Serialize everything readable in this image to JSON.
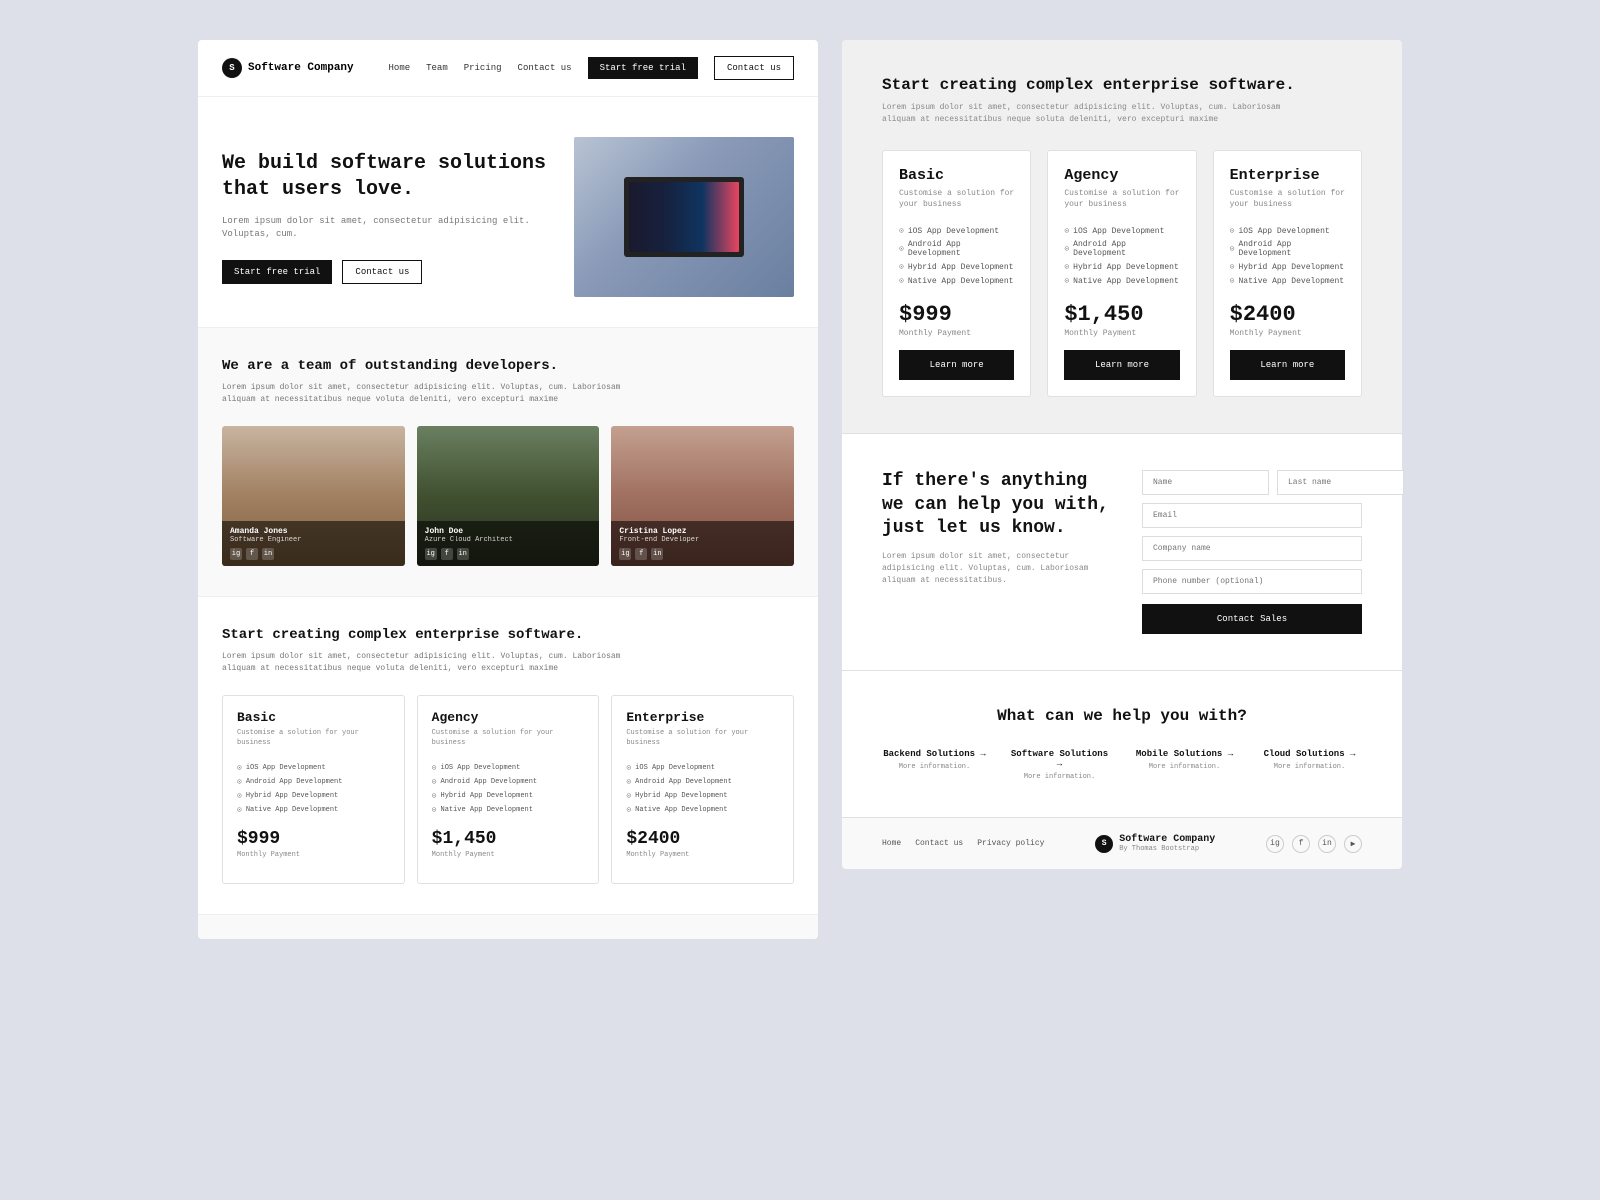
{
  "nav": {
    "logo_initial": "S",
    "logo_text": "Software Company",
    "links": [
      "Home",
      "Team",
      "Pricing",
      "Contact us"
    ],
    "cta_primary": "Start free trial",
    "cta_secondary": "Contact us"
  },
  "hero": {
    "title": "We build software solutions that users love.",
    "subtitle": "Lorem ipsum dolor sit amet, consectetur adipisicing elit. Voluptas, cum.",
    "btn_primary": "Start free trial",
    "btn_secondary": "Contact us"
  },
  "team": {
    "title": "We are a team of outstanding developers.",
    "subtitle": "Lorem ipsum dolor sit amet, consectetur adipisicing elit. Voluptas, cum. Laboriosam aliquam at necessitatibus neque voluta deleniti, vero excepturi maxime",
    "members": [
      {
        "name": "Amanda Jones",
        "role": "Software Engineer"
      },
      {
        "name": "John Doe",
        "role": "Azure Cloud Architect"
      },
      {
        "name": "Cristina Lopez",
        "role": "Front-end Developer"
      }
    ]
  },
  "left_pricing": {
    "title": "Start creating complex enterprise software.",
    "subtitle": "Lorem ipsum dolor sit amet, consectetur adipisicing elit. Voluptas, cum. Laboriosam aliquam at necessitatibus neque voluta deleniti, vero excepturi maxime",
    "plans": [
      {
        "name": "Basic",
        "desc": "Customise a solution for your business",
        "features": [
          "iOS App Development",
          "Android App Development",
          "Hybrid App Development",
          "Native App Development"
        ],
        "price": "$999",
        "period": "Monthly Payment"
      },
      {
        "name": "Agency",
        "desc": "Customise a solution for your business",
        "features": [
          "iOS App Development",
          "Android App Development",
          "Hybrid App Development",
          "Native App Development"
        ],
        "price": "$1,450",
        "period": "Monthly Payment"
      },
      {
        "name": "Enterprise",
        "desc": "Customise a solution for your business",
        "features": [
          "iOS App Development",
          "Android App Development",
          "Hybrid App Development",
          "Native App Development"
        ],
        "price": "$2400",
        "period": "Monthly Payment"
      }
    ]
  },
  "right_pricing": {
    "title": "Start creating complex enterprise software.",
    "subtitle": "Lorem ipsum dolor sit amet, consectetur adipisicing elit. Voluptas, cum. Laboriosam aliquam at necessitatibus neque soluta deleniti, vero excepturi maxime",
    "plans": [
      {
        "name": "Basic",
        "desc": "Customise a solution for your business",
        "features": [
          "iOS App Development",
          "Android App Development",
          "Hybrid App Development",
          "Native App Development"
        ],
        "price": "$999",
        "period": "Monthly Payment",
        "btn": "Learn more"
      },
      {
        "name": "Agency",
        "desc": "Customise a solution for your business",
        "features": [
          "iOS App Development",
          "Android App Development",
          "Hybrid App Development",
          "Native App Development"
        ],
        "price": "$1,450",
        "period": "Monthly Payment",
        "btn": "Learn more"
      },
      {
        "name": "Enterprise",
        "desc": "Customise a solution for your business",
        "features": [
          "iOS App Development",
          "Android App Development",
          "Hybrid App Development",
          "Native App Development"
        ],
        "price": "$2400",
        "period": "Monthly Payment",
        "btn": "Learn more"
      }
    ]
  },
  "contact": {
    "title": "If there's anything we can help you with, just let us know.",
    "subtitle": "Lorem ipsum dolor sit amet, consectetur adipisicing elit. Voluptas, cum. Laboriosam aliquam at necessitatibus.",
    "form": {
      "name_placeholder": "Name",
      "lastname_placeholder": "Last name",
      "email_placeholder": "Email",
      "company_placeholder": "Company name",
      "phone_placeholder": "Phone number (optional)",
      "submit_label": "Contact Sales"
    }
  },
  "help": {
    "title": "What can we help you with?",
    "items": [
      {
        "label": "Backend Solutions →",
        "sub": "More information."
      },
      {
        "label": "Software Solutions →",
        "sub": "More information."
      },
      {
        "label": "Mobile Solutions →",
        "sub": "More information."
      },
      {
        "label": "Cloud Solutions →",
        "sub": "More information."
      }
    ]
  },
  "footer": {
    "links": [
      "Home",
      "Contact us",
      "Privacy policy"
    ],
    "logo_initial": "S",
    "logo_text": "Software Company",
    "logo_sub": "By Thomas Bootstrap",
    "socials": [
      "ig",
      "fb",
      "in",
      "yt"
    ]
  }
}
